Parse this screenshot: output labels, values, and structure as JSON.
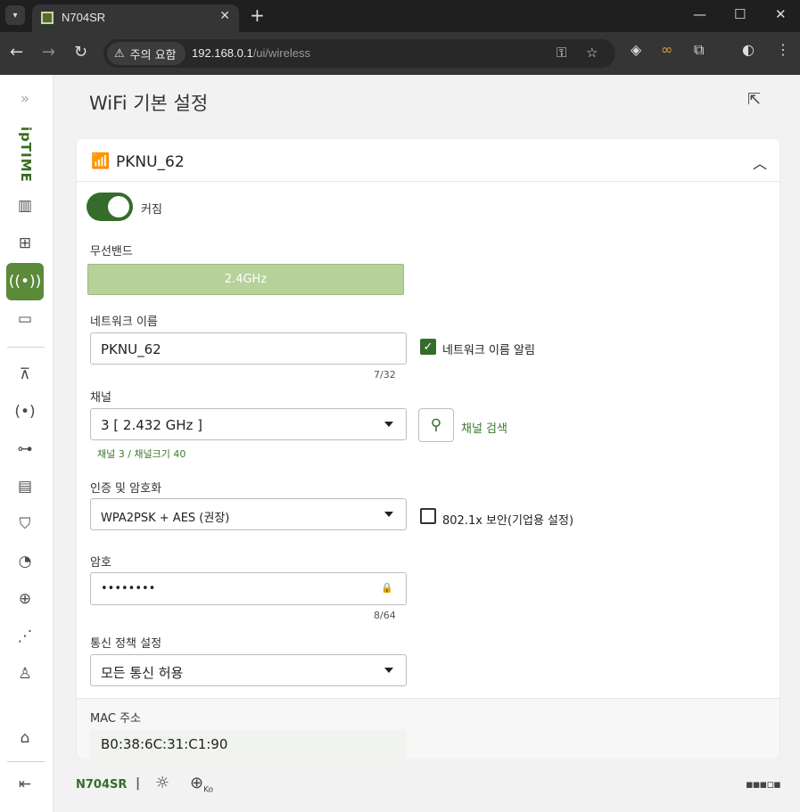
{
  "browser": {
    "tab_title": "N704SR",
    "security_chip": "주의 요함",
    "url_host": "192.168.0.1",
    "url_path": "/ui/wireless"
  },
  "rail": {
    "logo": "ipTIME",
    "items": [
      "expand-icon",
      "bar-chart-icon",
      "web-settings-icon",
      "wireless-icon",
      "device-icon",
      "network-icon",
      "antenna-icon",
      "topology-icon",
      "router-icon",
      "security-shield-icon",
      "speed-gauge-icon",
      "global-network-icon",
      "graph-icon",
      "user-icon",
      "home-icon",
      "logout-icon"
    ]
  },
  "page": {
    "title": "WiFi 기본 설정"
  },
  "card": {
    "ssid_title": "PKNU_62",
    "toggle_label": "커짐",
    "toggle_on": true,
    "band_label": "무선밴드",
    "band_value": "2.4GHz",
    "network_name_label": "네트워크 이름",
    "network_name_value": "PKNU_62",
    "network_name_counter": "7/32",
    "broadcast_label": "네트워크 이름 알림",
    "broadcast_checked": true,
    "channel_label": "채널",
    "channel_value": "3 [ 2.432 GHz ]",
    "channel_search_label": "채널 검색",
    "channel_hint": "채널 3 / 채널크기 40",
    "auth_label": "인증 및 암호화",
    "auth_value": "WPA2PSK + AES (권장)",
    "enterprise_label": "802.1x 보안(기업용 설정)",
    "enterprise_checked": false,
    "password_label": "암호",
    "password_value": "••••••••",
    "password_counter": "8/64",
    "policy_label": "통신 정책 설정",
    "policy_value": "모든 통신 허용",
    "mac_label": "MAC 주소",
    "mac_value": "B0:38:6C:31:C1:90"
  },
  "footer": {
    "model": "N704SR",
    "separator": "|",
    "language_badge": "Ko"
  },
  "colors": {
    "accent": "#356c2a",
    "band_button": "#b6d19a",
    "rail_active": "#5b8a3a"
  }
}
